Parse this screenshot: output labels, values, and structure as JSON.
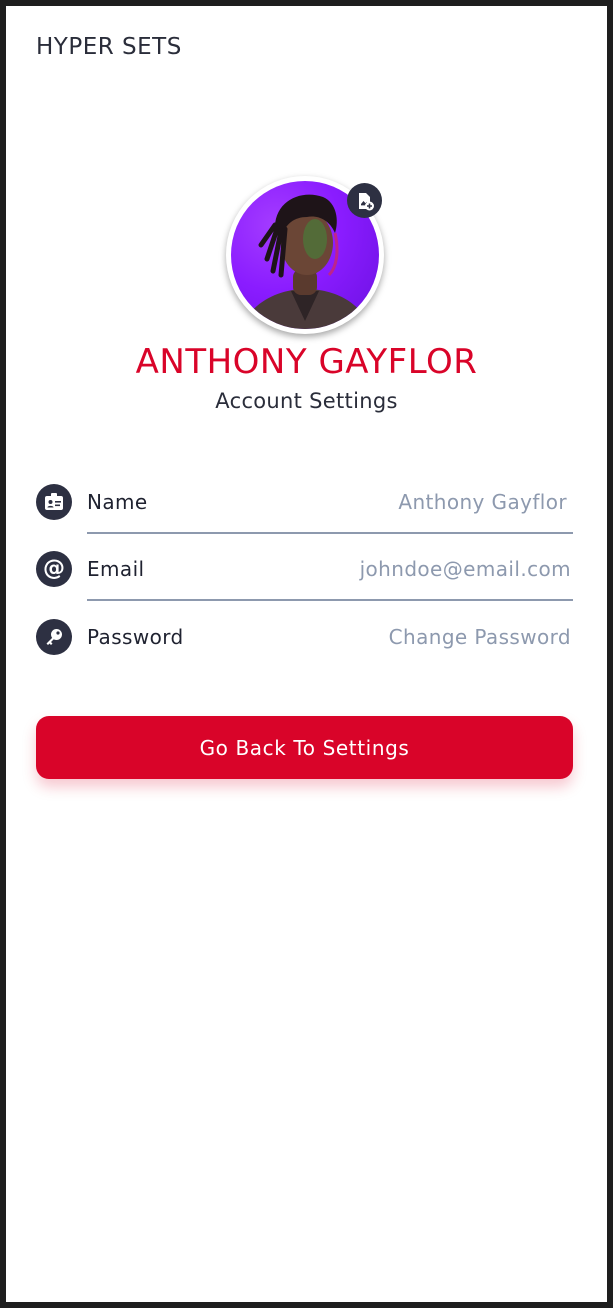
{
  "app": {
    "title": "HYPER SETS"
  },
  "profile": {
    "name": "ANTHONY GAYFLOR",
    "subtitle": "Account Settings",
    "avatar_alt": "profile-photo",
    "edit_icon": "add-photo-icon"
  },
  "fields": [
    {
      "icon": "id-card-icon",
      "label": "Name",
      "value": "Anthony Gayflor"
    },
    {
      "icon": "at-sign-icon",
      "label": "Email",
      "value": "johndoe@email.com"
    },
    {
      "icon": "key-icon",
      "label": "Password",
      "value": "Change Password"
    }
  ],
  "actions": {
    "back_label": "Go Back To Settings"
  },
  "colors": {
    "accent": "#d90429",
    "dark": "#2d3042",
    "muted": "#8d99ae",
    "avatar_bg": "#8a1cff"
  }
}
